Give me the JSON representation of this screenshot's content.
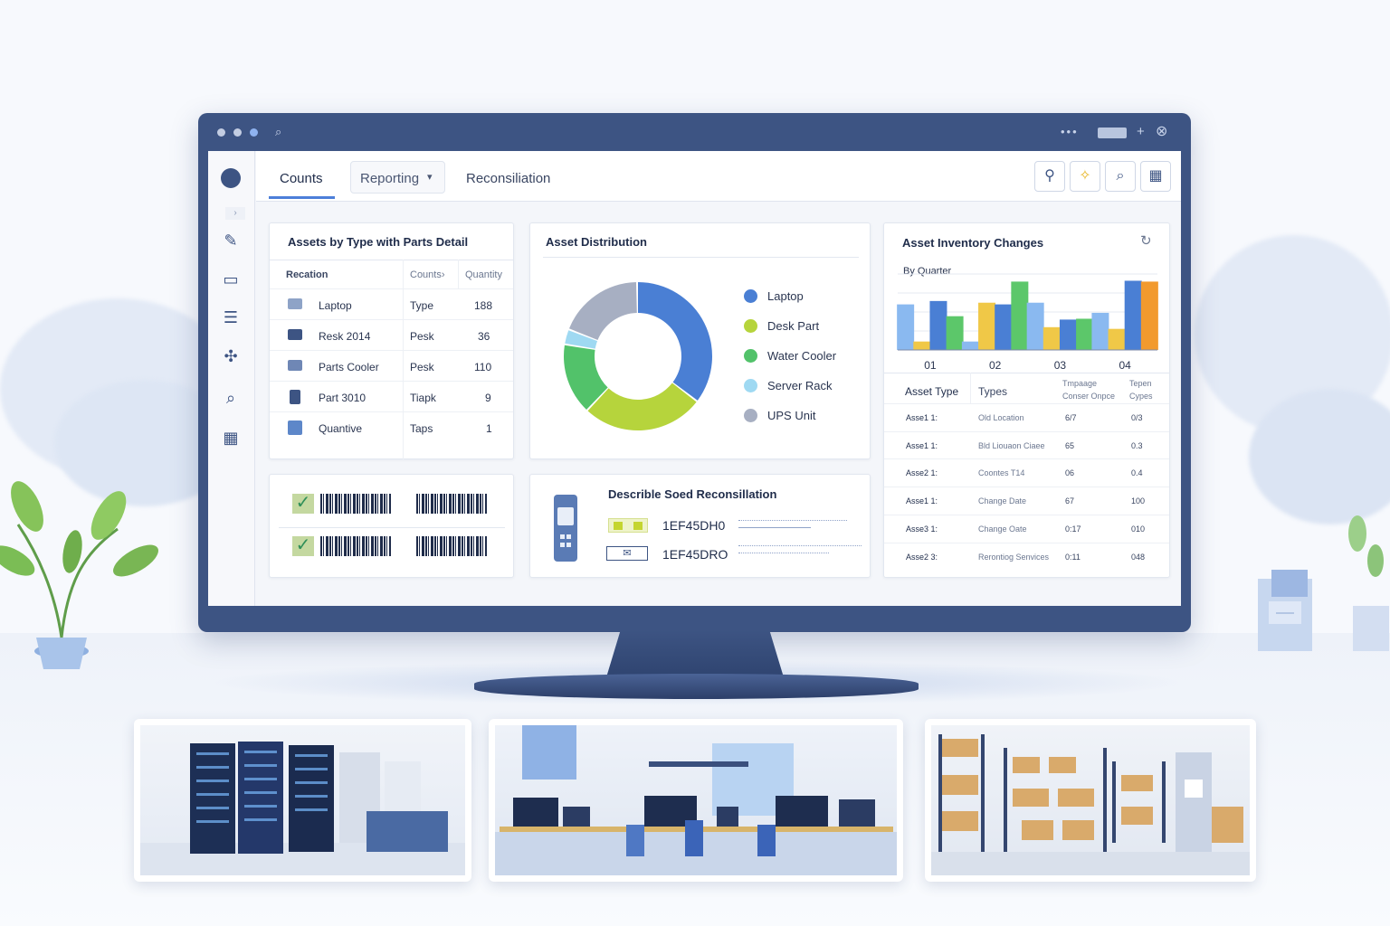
{
  "tabs": {
    "counts": "Counts",
    "reporting": "Reporting",
    "reconciliation": "Reconsiliation"
  },
  "assets_table": {
    "title": "Assets by Type with Parts Detail",
    "headers": [
      "Recation",
      "Counts›",
      "Quantity"
    ],
    "rows": [
      {
        "name": "Laptop",
        "type": "Type",
        "qty": "188"
      },
      {
        "name": "Resk 2014",
        "type": "Pesk",
        "qty": "36"
      },
      {
        "name": "Parts Cooler",
        "type": "Pesk",
        "qty": "110"
      },
      {
        "name": "Part 3010",
        "type": "Tiapk",
        "qty": "9"
      },
      {
        "name": "Quantive",
        "type": "Taps",
        "qty": "1"
      }
    ]
  },
  "distribution": {
    "title": "Asset Distribution",
    "legend": [
      "Laptop",
      "Desk Part",
      "Water Cooler",
      "Server Rack",
      "UPS Unit"
    ],
    "colors": [
      "#4a7fd4",
      "#b6d43c",
      "#52c26a",
      "#9fd9f2",
      "#a7afc2"
    ]
  },
  "inventory_changes": {
    "title": "Asset Inventory Changes",
    "subtitle": "By Quarter",
    "quarters": [
      "01",
      "02",
      "03",
      "04"
    ],
    "table_headers": [
      "Asset Type",
      "Types",
      "Tmpaage Conser Onpce",
      "Tepen Cypes"
    ],
    "rows": [
      {
        "asset": "Asse1 1:",
        "type": "Old Location",
        "a": "6/7",
        "b": "0/3"
      },
      {
        "asset": "Asse1 1:",
        "type": "Bld Liouaon Ciaee",
        "a": "65",
        "b": "0.3"
      },
      {
        "asset": "Asse2 1:",
        "type": "Coontes T14",
        "a": "06",
        "b": "0.4"
      },
      {
        "asset": "Asse1 1:",
        "type": "Change Date",
        "a": "67",
        "b": "100"
      },
      {
        "asset": "Asse3 1:",
        "type": "Change Oate",
        "a": "0:17",
        "b": "010"
      },
      {
        "asset": "Asse2 3:",
        "type": "Rerontiog Senvices",
        "a": "0:11",
        "b": "048"
      }
    ]
  },
  "reconciliation": {
    "title": "Describle Soed Reconsillation",
    "codes": [
      "1EF45DH0",
      "1EF45DRO"
    ]
  },
  "chart_data": [
    {
      "type": "pie",
      "title": "Asset Distribution",
      "categories": [
        "Laptop",
        "Desk Part",
        "Water Cooler",
        "Server Rack",
        "UPS Unit"
      ],
      "values": [
        32,
        24,
        14,
        3,
        17
      ]
    },
    {
      "type": "bar",
      "title": "Asset Inventory Changes",
      "subtitle": "By Quarter",
      "categories": [
        "01",
        "02",
        "03",
        "04"
      ],
      "series": [
        {
          "color": "#8ab9f0",
          "values": [
            5.4,
            1.0,
            5.6,
            4.4
          ]
        },
        {
          "color": "#f0c847",
          "values": [
            1.0,
            5.6,
            2.7,
            2.5
          ]
        },
        {
          "color": "#4a7fd4",
          "values": [
            5.8,
            5.4,
            3.6,
            8.2
          ]
        },
        {
          "color": "#5cc76a",
          "values": [
            4.0,
            8.1,
            3.7,
            0
          ]
        },
        {
          "color": "#f29a2e",
          "values": [
            0,
            0,
            0,
            8.1
          ]
        }
      ],
      "ylim": [
        0,
        9
      ]
    }
  ]
}
